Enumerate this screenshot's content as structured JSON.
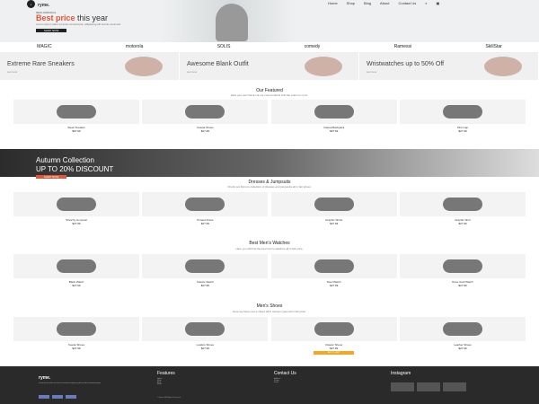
{
  "logo": {
    "name": "ryme."
  },
  "menu": [
    "Home",
    "Shop",
    "Blog",
    "About",
    "Contact Us"
  ],
  "hero": {
    "kicker": "NEW ARRIVALS",
    "title_main": "Best price",
    "title_rest": " this year",
    "sub": "Lorem ipsum dolor sit amet consectetur, adipiscing elit sed do eiusmod",
    "button": "SHOP NOW"
  },
  "brands": [
    "MAGIC",
    "motorola",
    "SOLIS",
    "comedy",
    "Ramessi",
    "SkillStar"
  ],
  "promos": [
    {
      "title": "Extreme Rare Sneakers",
      "link": "SHOP NOW"
    },
    {
      "title": "Awesome Blank Outfit",
      "link": "SHOP NOW"
    },
    {
      "title": "Wristwatches up to 50% Off",
      "link": "SHOP NOW"
    }
  ],
  "featured": {
    "title": "Our Featured",
    "sub": "Here you can check out our new products with fair price on rymo.",
    "items": [
      {
        "name": "Sleek Sneaker",
        "price": "$97.99"
      },
      {
        "name": "Casual Shoes",
        "price": "$27.99"
      },
      {
        "name": "Casual Backpack",
        "price": "$97.99"
      },
      {
        "name": "Pink Cap",
        "price": "$27.99"
      }
    ]
  },
  "autumn": {
    "line1": "Autumn Collection",
    "line2": "UP TO 20% DISCOUNT",
    "button": "SHOP NOW"
  },
  "dresses": {
    "title": "Dresses & Jumpsuits",
    "sub": "Check out Rymo's collection of dresses and jumpsuits all in fair prices.",
    "items": [
      {
        "name": "Stretchy Jumpsuit",
        "price": "$27.99"
      },
      {
        "name": "Printed Dress",
        "price": "$27.99"
      },
      {
        "name": "Graphic Shirts",
        "price": "$27.99"
      },
      {
        "name": "Graphic Shirt",
        "price": "$27.99"
      }
    ]
  },
  "watches": {
    "title": "Best Men's Watches",
    "sub": "Here you will find the best men's watches all in fair price.",
    "items": [
      {
        "name": "Black Watch",
        "price": "$27.99"
      },
      {
        "name": "Classic Watch",
        "price": "$27.99"
      },
      {
        "name": "Steel Watch",
        "price": "$27.99"
      },
      {
        "name": "Rose Gold Watch",
        "price": "$27.99"
      }
    ]
  },
  "shoes": {
    "title": "Men's Shoes",
    "sub": "Here we have men's shoes all in various types all in fair price.",
    "items": [
      {
        "name": "Suede Shoes",
        "price": "$27.99"
      },
      {
        "name": "Loafers Shoes",
        "price": "$27.99"
      },
      {
        "name": "Classic Shoes",
        "price": "$27.99",
        "badge": "ADD TO CART"
      },
      {
        "name": "Leather Shoes",
        "price": "$27.99"
      }
    ]
  },
  "footer": {
    "brand": "ryme.",
    "about": "Lorem ipsum dolor sit amet consectetur adipiscing elit sed do eiusmod tempor.",
    "features": [
      "Features",
      "Home",
      "Shop",
      "Blog",
      "About"
    ],
    "contact": {
      "title": "Contact Us",
      "lines": [
        "Address",
        "Phone",
        "Email"
      ]
    },
    "instagram": "Instagram",
    "copyright": "© Rymo. All Rights Reserved."
  }
}
